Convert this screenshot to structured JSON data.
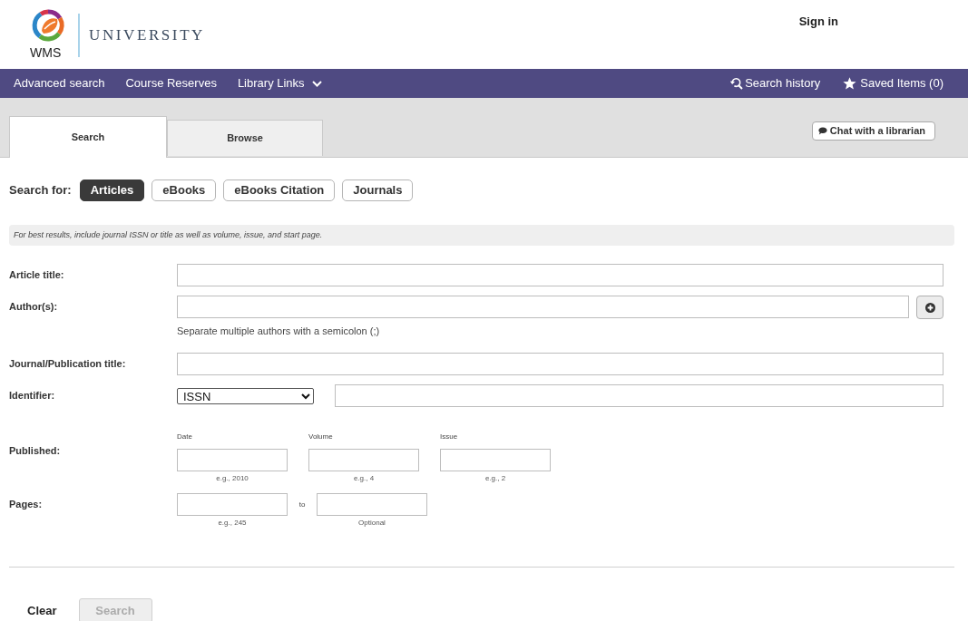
{
  "header": {
    "logo_text": "WMS",
    "wordmark": "UNIVERSITY",
    "sign_in": "Sign in"
  },
  "nav": {
    "left": [
      {
        "label": "Advanced search",
        "kind": "link"
      },
      {
        "label": "Course Reserves",
        "kind": "link"
      },
      {
        "label": "Library Links",
        "kind": "dropdown"
      }
    ],
    "right": [
      {
        "label": "Search history",
        "kind": "history"
      },
      {
        "label": "Saved Items (0)",
        "kind": "saved"
      }
    ]
  },
  "tabs": [
    {
      "label": "Search",
      "selected": true
    },
    {
      "label": "Browse",
      "selected": false
    }
  ],
  "chat_button": "Chat with a librarian",
  "search_for": {
    "label": "Search for:",
    "options": [
      {
        "label": "Articles",
        "selected": true
      },
      {
        "label": "eBooks",
        "selected": false
      },
      {
        "label": "eBooks Citation",
        "selected": false
      },
      {
        "label": "Journals",
        "selected": false
      }
    ]
  },
  "notice": "For best results, include journal ISSN or title as well as volume, issue, and start page.",
  "fields": [
    {
      "kind": "text",
      "label": "Article title:"
    },
    {
      "kind": "text_add",
      "label": "Author(s):",
      "hint": "Separate multiple authors with a semicolon (;)"
    },
    {
      "kind": "text",
      "label": "Journal/Publication title:"
    },
    {
      "kind": "identifier",
      "label": "Identifier:",
      "select_value": "ISSN"
    },
    {
      "kind": "triple",
      "label": "Published:",
      "parts": [
        {
          "caption": "Date",
          "hint": "e.g., 2010"
        },
        {
          "caption": "Volume",
          "hint": "e.g., 4"
        },
        {
          "caption": "Issue",
          "hint": "e.g., 2"
        }
      ]
    },
    {
      "kind": "range",
      "label": "Pages:",
      "separator": "to",
      "parts": [
        {
          "hint": "e.g., 245"
        },
        {
          "hint": "Optional"
        }
      ]
    }
  ],
  "actions": {
    "clear": "Clear",
    "search": {
      "label": "Search",
      "disabled": true
    }
  }
}
